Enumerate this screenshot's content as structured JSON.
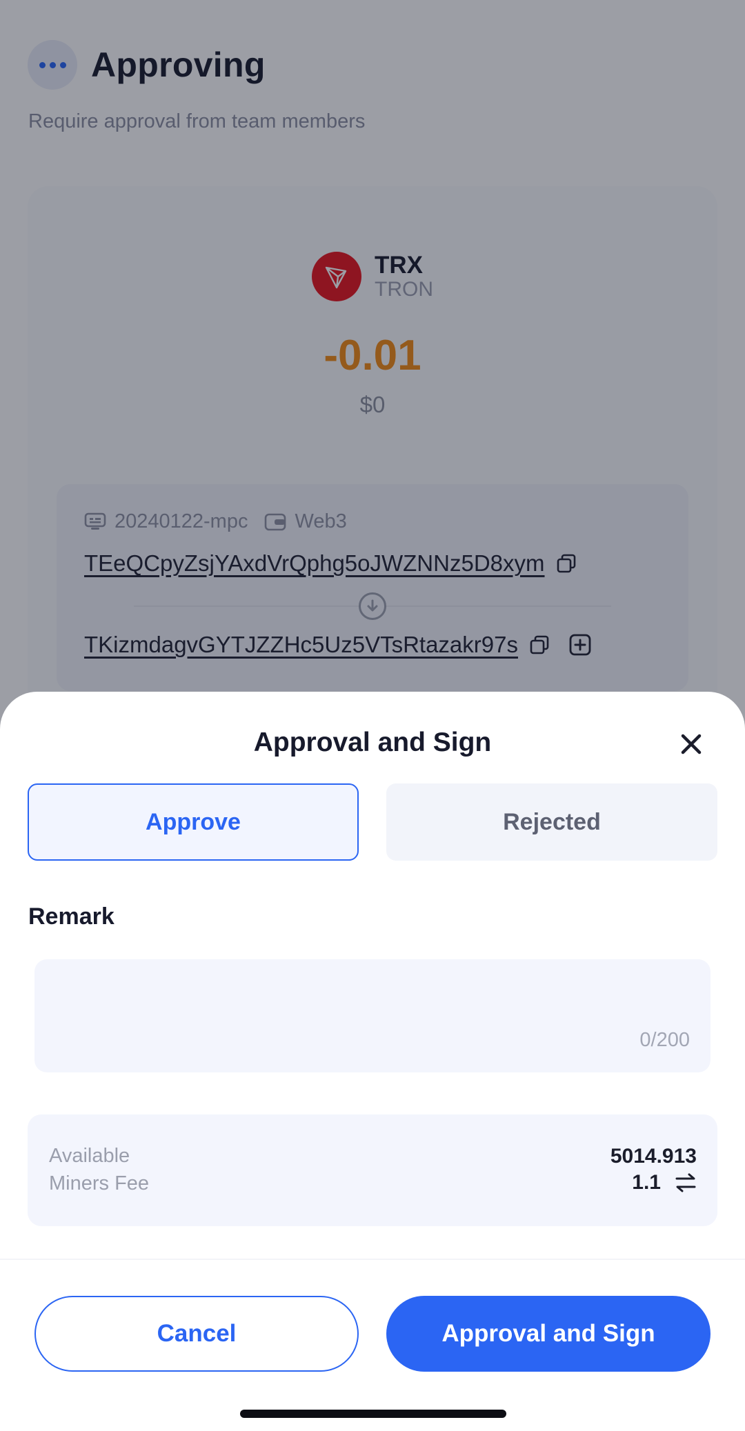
{
  "header": {
    "title": "Approving",
    "subtitle": "Require approval from team members",
    "menu_icon": "more-dots-icon"
  },
  "transaction": {
    "token_symbol": "TRX",
    "token_network": "TRON",
    "amount": "-0.01",
    "fiat_value": "$0",
    "wallet_name": "20240122-mpc",
    "wallet_type": "Web3",
    "from_address": "TEeQCpyZsjYAxdVrQphg5oJWZNNz5D8xym",
    "to_address": "TKizmdagvGYTJZZHc5Uz5VTsRtazakr97s"
  },
  "sheet": {
    "title": "Approval and Sign",
    "approve_label": "Approve",
    "reject_label": "Rejected",
    "remark_label": "Remark",
    "remark_value": "",
    "remark_counter": "0/200",
    "available_label": "Available",
    "available_value": "5014.913",
    "fee_label": "Miners Fee",
    "fee_value": "1.1",
    "cancel_label": "Cancel",
    "sign_label": "Approval and Sign"
  },
  "colors": {
    "accent": "#2b65f3",
    "amount": "#f28a14",
    "tron_red": "#e7141d"
  }
}
